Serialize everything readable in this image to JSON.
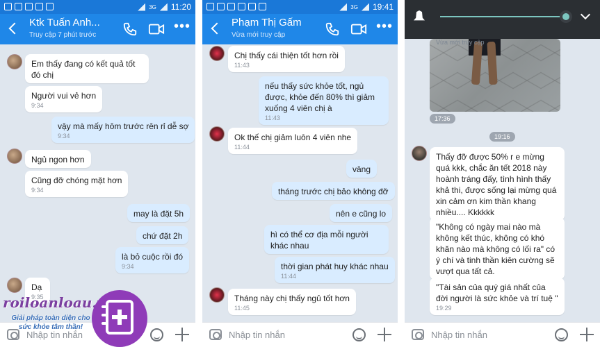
{
  "panels": [
    {
      "status": {
        "time": "11:20",
        "network": "3G"
      },
      "contact_name": "Ktk Tuấn Anh...",
      "last_seen": "Truy cập 7 phút trước",
      "messages": [
        {
          "text": "Em thấy đang có kết quả tốt đó chị",
          "time": ""
        },
        {
          "text": "Người vui vẻ hơn",
          "time": "9:34"
        },
        {
          "text": "vậy mà mấy hôm trước rên rỉ dễ sợ",
          "time": "9:34"
        },
        {
          "text": "Ngủ ngon hơn",
          "time": ""
        },
        {
          "text": "Cũng đỡ chóng mặt hơn",
          "time": "9:34"
        },
        {
          "text": "may là đặt 5h",
          "time": ""
        },
        {
          "text": "chứ đặt 2h",
          "time": ""
        },
        {
          "text": "là bỏ cuộc rồi đó",
          "time": "9:34"
        },
        {
          "text": "Dạ",
          "time": "9:35"
        }
      ],
      "input_placeholder": "Nhập tin nhắn"
    },
    {
      "status": {
        "time": "19:41",
        "network": "3G"
      },
      "contact_name": "Phạm Thị Gấm",
      "last_seen": "Vừa mới truy cập",
      "messages": [
        {
          "text": "Chị thấy cái thiện tốt hơn rồi",
          "time": "11:43"
        },
        {
          "text": "nếu thấy sức khỏe tốt, ngủ được, khỏe đến 80% thì giảm xuống 4 viên chị à",
          "time": "11:43"
        },
        {
          "text": "Ok thế chị giảm luôn 4 viên nhe",
          "time": "11:44"
        },
        {
          "text": "vâng",
          "time": ""
        },
        {
          "text": "tháng trước chị bảo không đỡ",
          "time": ""
        },
        {
          "text": "nên e cũng lo",
          "time": ""
        },
        {
          "text": "hì có thể cơ địa mỗi người khác nhau",
          "time": ""
        },
        {
          "text": "thời gian phát huy khác nhau",
          "time": "11:44"
        },
        {
          "text": "Tháng này chị thấy ngủ tốt hơn",
          "time": "11:45"
        }
      ],
      "input_placeholder": "Nhập tin nhắn"
    },
    {
      "caption_top": "Vừa mới truy cập",
      "photo_time": "17:36",
      "divider_time": "19:16",
      "messages": [
        {
          "text": "Thấy đỡ  được 50% r e mừng quá kkk, chắc ăn tết 2018 này hoành tráng đấy, tình hình thấy khả thi, được sống lại mừng quá xin cảm ơn kim thần khang nhiều.... Kkkkkk",
          "time": ""
        },
        {
          "text": "\"Không có ngày mai nào mà không kết thúc, không có khó khăn nào mà không có lối ra\" có ý chí và tinh thần kiên cường sẽ vượt qua tất cả.",
          "time": ""
        },
        {
          "text": "\"Tài sản của quý giá nhất của đời người là sức khỏe và trí tuệ \"",
          "time": "19:29"
        }
      ],
      "input_placeholder": "Nhập tin nhắn"
    }
  ],
  "watermark": {
    "brand": "roiloanloau.vn",
    "tagline": "Giải pháp toàn diện cho sức khỏe tâm thần!"
  }
}
